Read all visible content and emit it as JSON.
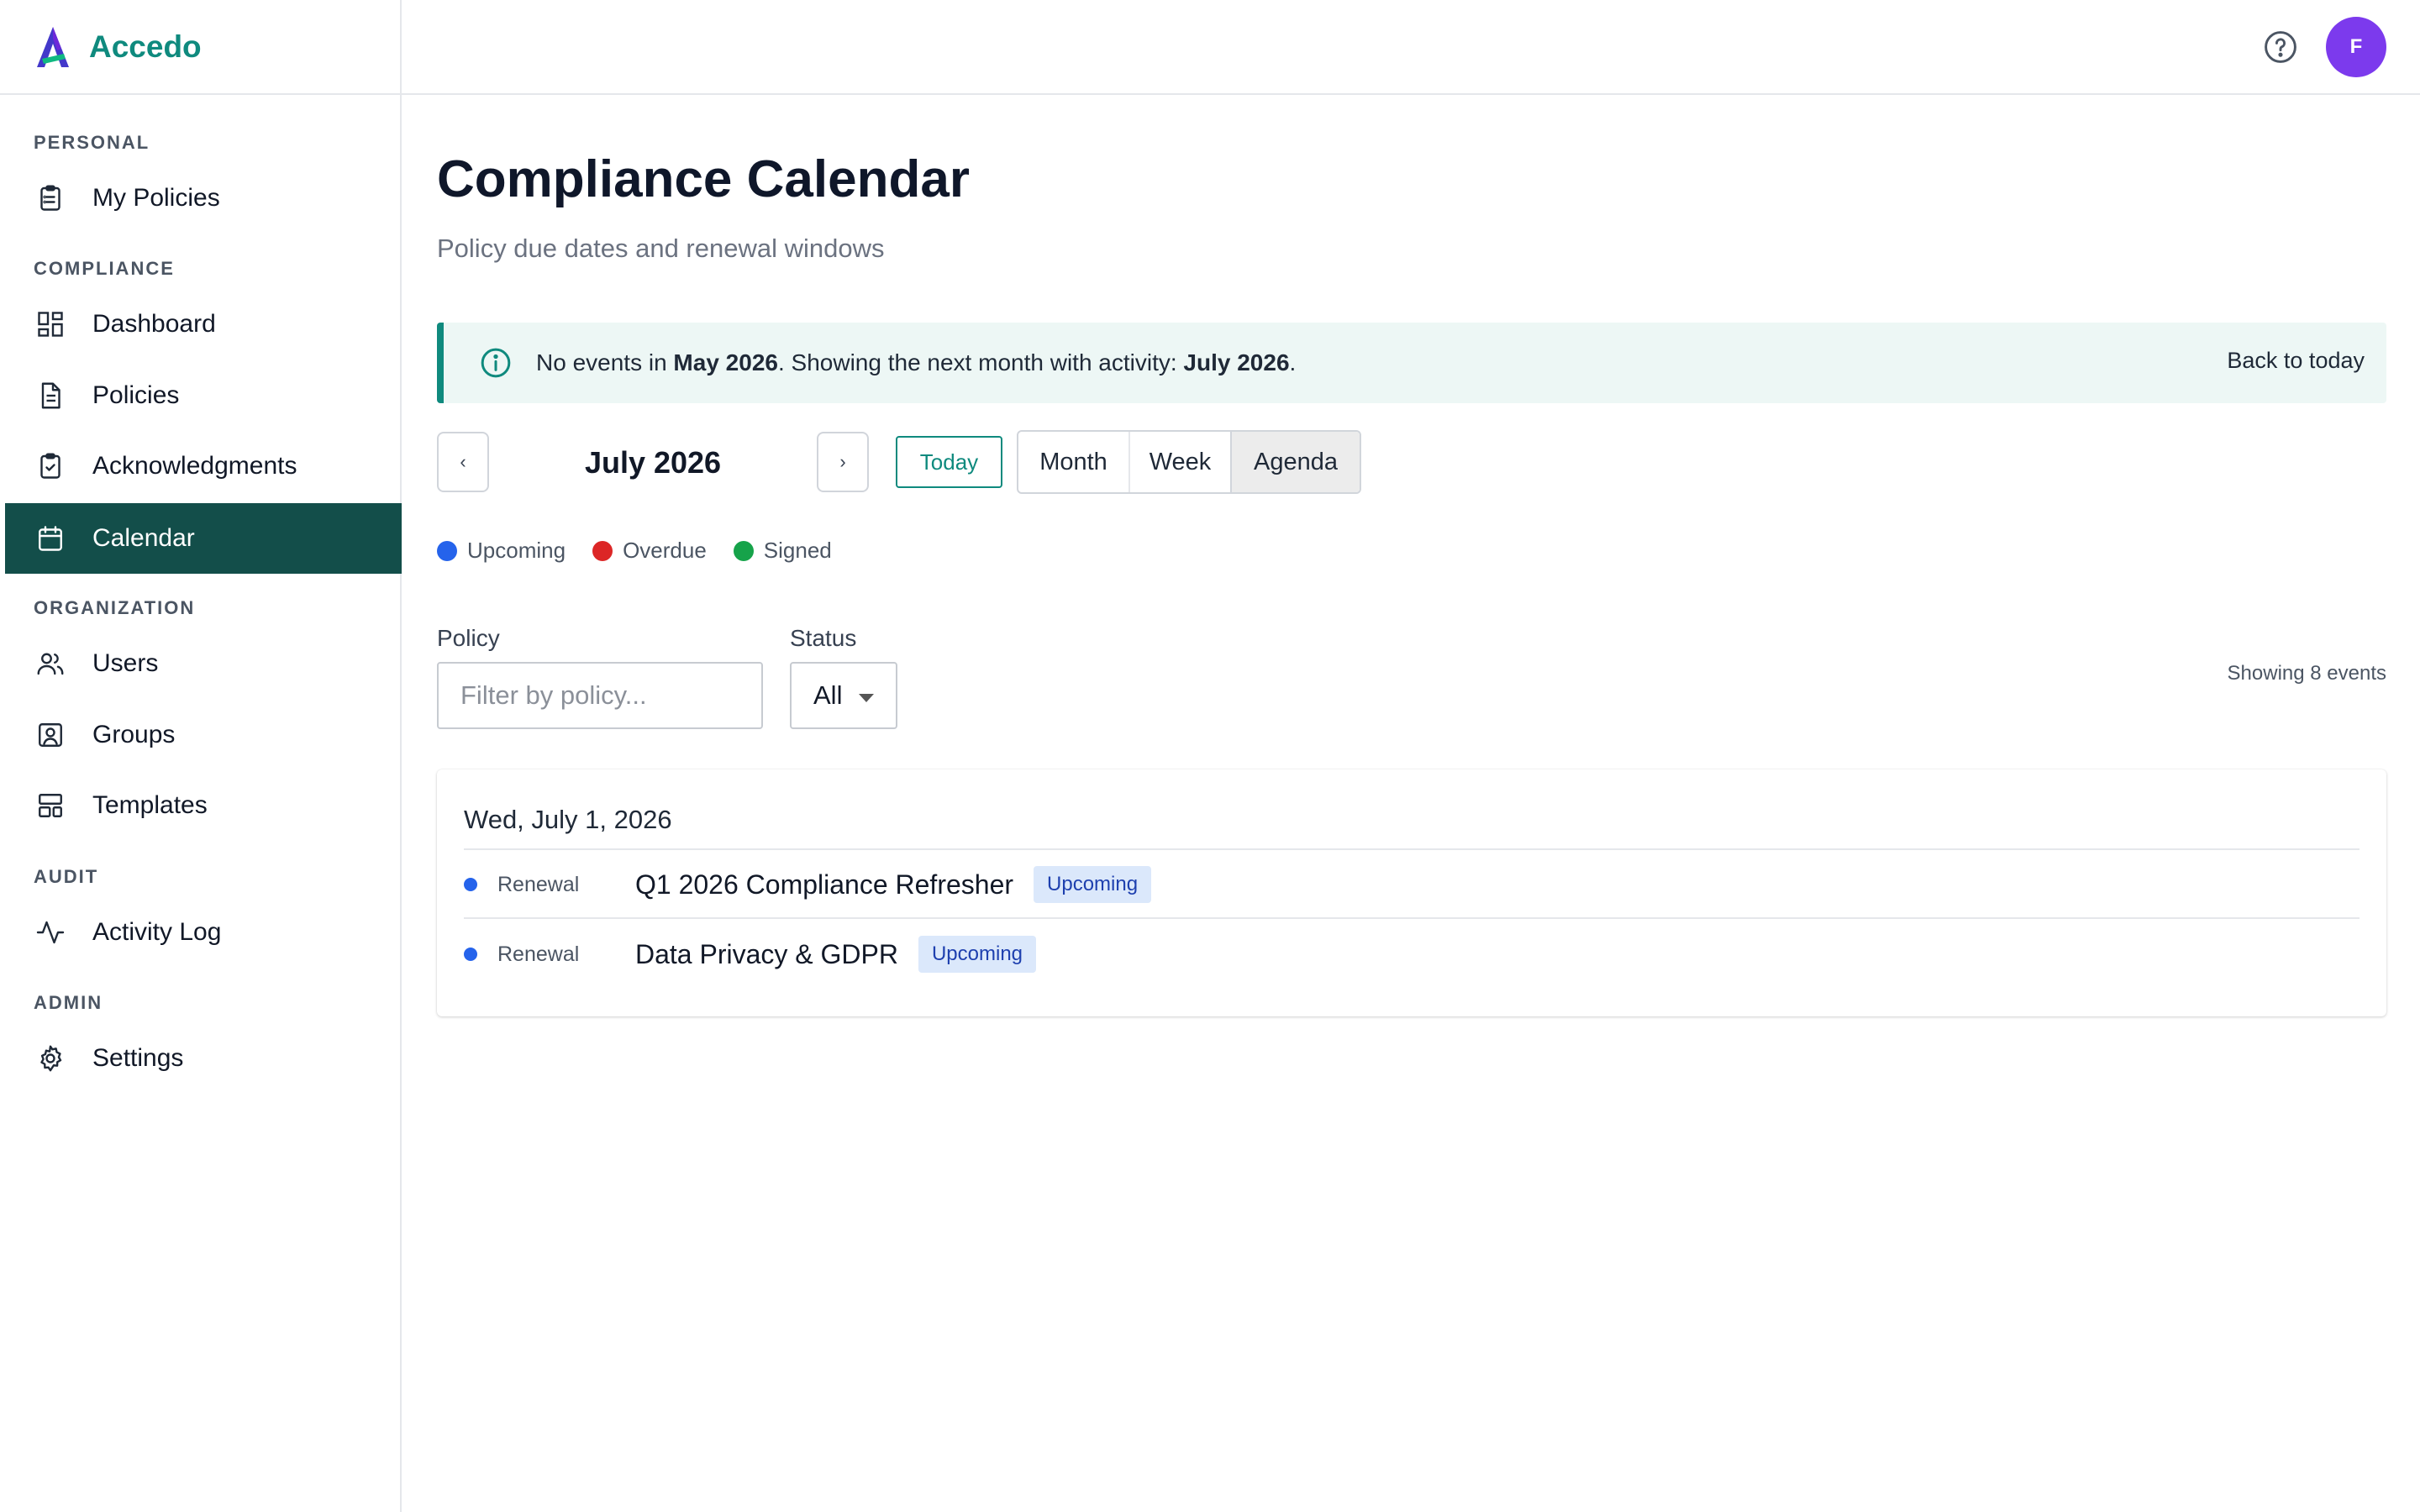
{
  "app": {
    "name": "Accedo"
  },
  "header": {
    "avatar_initial": "F"
  },
  "sidebar": {
    "sections": [
      {
        "title": "PERSONAL",
        "items": [
          {
            "label": "My Policies",
            "icon": "clipboard-icon"
          }
        ]
      },
      {
        "title": "COMPLIANCE",
        "items": [
          {
            "label": "Dashboard",
            "icon": "dashboard-icon"
          },
          {
            "label": "Policies",
            "icon": "document-icon"
          },
          {
            "label": "Acknowledgments",
            "icon": "clipboard-check-icon"
          },
          {
            "label": "Calendar",
            "icon": "calendar-icon",
            "active": true
          }
        ]
      },
      {
        "title": "ORGANIZATION",
        "items": [
          {
            "label": "Users",
            "icon": "users-icon"
          },
          {
            "label": "Groups",
            "icon": "group-icon"
          },
          {
            "label": "Templates",
            "icon": "templates-icon"
          }
        ]
      },
      {
        "title": "AUDIT",
        "items": [
          {
            "label": "Activity Log",
            "icon": "activity-icon"
          }
        ]
      },
      {
        "title": "ADMIN",
        "items": [
          {
            "label": "Settings",
            "icon": "gear-icon"
          }
        ]
      }
    ]
  },
  "page": {
    "title": "Compliance Calendar",
    "subtitle": "Policy due dates and renewal windows"
  },
  "banner": {
    "text_1": "No events in ",
    "bold_1": "May 2026",
    "text_2": ". Showing the next month with activity: ",
    "bold_2": "July 2026",
    "text_3": ".",
    "back_label": "Back to today"
  },
  "toolbar": {
    "prev_label": "‹",
    "next_label": "›",
    "month_label": "July 2026",
    "today_label": "Today",
    "views": [
      "Month",
      "Week",
      "Agenda"
    ],
    "active_view": "Agenda"
  },
  "legend": [
    {
      "label": "Upcoming",
      "color": "#2563eb"
    },
    {
      "label": "Overdue",
      "color": "#dc2626"
    },
    {
      "label": "Signed",
      "color": "#16a34a"
    }
  ],
  "filters": {
    "policy_label": "Policy",
    "policy_placeholder": "Filter by policy...",
    "policy_value": "",
    "status_label": "Status",
    "status_value": "All",
    "showing_text": "Showing 8 events"
  },
  "agenda": {
    "days": [
      {
        "date": "Wed, July 1, 2026",
        "events": [
          {
            "type": "Renewal",
            "title": "Q1 2026 Compliance Refresher",
            "status": "Upcoming",
            "color": "#2563eb"
          },
          {
            "type": "Renewal",
            "title": "Data Privacy & GDPR",
            "status": "Upcoming",
            "color": "#2563eb"
          }
        ]
      }
    ]
  }
}
